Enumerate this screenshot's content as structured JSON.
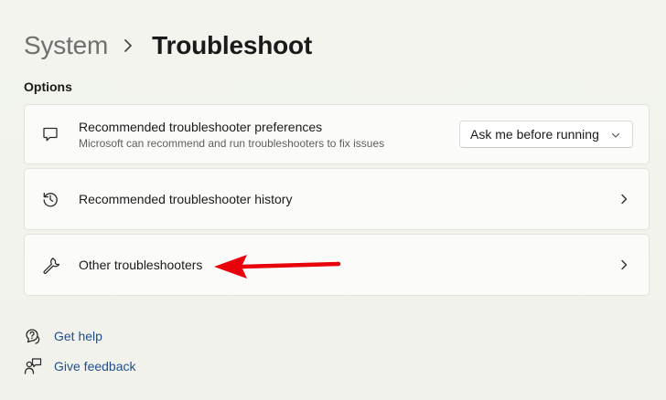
{
  "breadcrumb": {
    "parent": "System",
    "separator_icon": "chevron-right-icon",
    "current": "Troubleshoot"
  },
  "section": {
    "label": "Options"
  },
  "cards": [
    {
      "icon": "chat-bubble-icon",
      "title": "Recommended troubleshooter preferences",
      "subtitle": "Microsoft can recommend and run troubleshooters to fix issues",
      "dropdown": {
        "value": "Ask me before running",
        "icon": "chevron-down-icon"
      }
    },
    {
      "icon": "history-icon",
      "title": "Recommended troubleshooter history",
      "action_icon": "chevron-right-icon"
    },
    {
      "icon": "wrench-icon",
      "title": "Other troubleshooters",
      "action_icon": "chevron-right-icon"
    }
  ],
  "annotation": {
    "icon": "red-arrow-icon",
    "color": "#e8000b"
  },
  "links": [
    {
      "icon": "help-icon",
      "label": "Get help"
    },
    {
      "icon": "feedback-icon",
      "label": "Give feedback"
    }
  ],
  "colors": {
    "background": "#f2f3ec",
    "card": "#fbfbf9",
    "link": "#1f4f8f",
    "annotation": "#e8000b"
  }
}
